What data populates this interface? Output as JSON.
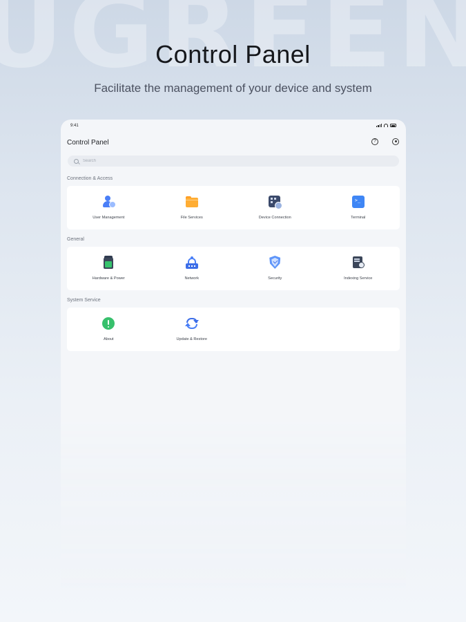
{
  "watermark": "UGREEN",
  "headline": "Control Panel",
  "subheadline": "Facilitate the management of your device and system",
  "status_bar": {
    "time": "9:41"
  },
  "app": {
    "title": "Control Panel",
    "search_placeholder": "Search"
  },
  "sections": [
    {
      "label": "Connection & Access",
      "items": [
        {
          "label": "User Management",
          "icon": "user-management-icon"
        },
        {
          "label": "File Services",
          "icon": "folder-icon"
        },
        {
          "label": "Device Connection",
          "icon": "device-connection-icon"
        },
        {
          "label": "Terminal",
          "icon": "terminal-icon"
        }
      ]
    },
    {
      "label": "General",
      "items": [
        {
          "label": "Hardware & Power",
          "icon": "battery-icon"
        },
        {
          "label": "Network",
          "icon": "router-icon"
        },
        {
          "label": "Security",
          "icon": "shield-icon"
        },
        {
          "label": "Indexing Service",
          "icon": "indexing-icon"
        }
      ]
    },
    {
      "label": "System Service",
      "items": [
        {
          "label": "About",
          "icon": "info-icon"
        },
        {
          "label": "Update & Restore",
          "icon": "refresh-icon"
        }
      ]
    }
  ],
  "colors": {
    "accent_blue": "#4a7ff7",
    "folder_orange": "#ffad33",
    "about_green": "#37c06c"
  }
}
